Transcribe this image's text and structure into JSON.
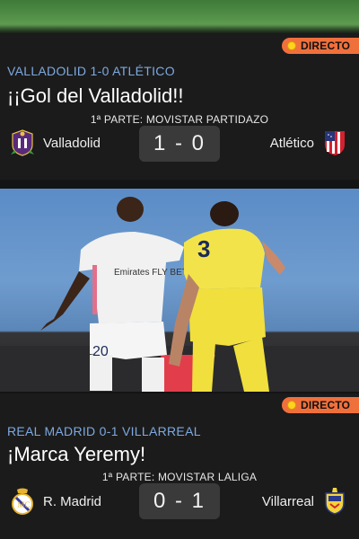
{
  "live_label": "DIRECTO",
  "cards": [
    {
      "match_title": "VALLADOLID 1-0 ATLÉTICO",
      "headline": "¡¡Gol del Valladolid!!",
      "subtitle": "1ª PARTE: MOVISTAR PARTIDAZO",
      "home_team": "Valladolid",
      "away_team": "Atlético",
      "score": "1 - 0"
    },
    {
      "match_title": "REAL MADRID 0-1 VILLARREAL",
      "headline": "¡Marca Yeremy!",
      "subtitle": "1ª PARTE: MOVISTAR LALIGA",
      "home_team": "R. Madrid",
      "away_team": "Villarreal",
      "score": "0 - 1"
    }
  ],
  "photo": {
    "jersey_number_white": "20",
    "jersey_number_yellow": "3",
    "sponsor_text": "Emirates FLY BETTER"
  },
  "colors": {
    "live_badge": "#f0703c",
    "live_dot": "#ffd21e",
    "match_title": "#7ea9e0",
    "card_bg": "#1b1b1b",
    "score_bg": "#3a3a3a"
  },
  "icons": [
    "valladolid-crest-icon",
    "atletico-crest-icon",
    "real-madrid-crest-icon",
    "villarreal-crest-icon",
    "live-dot-icon"
  ]
}
